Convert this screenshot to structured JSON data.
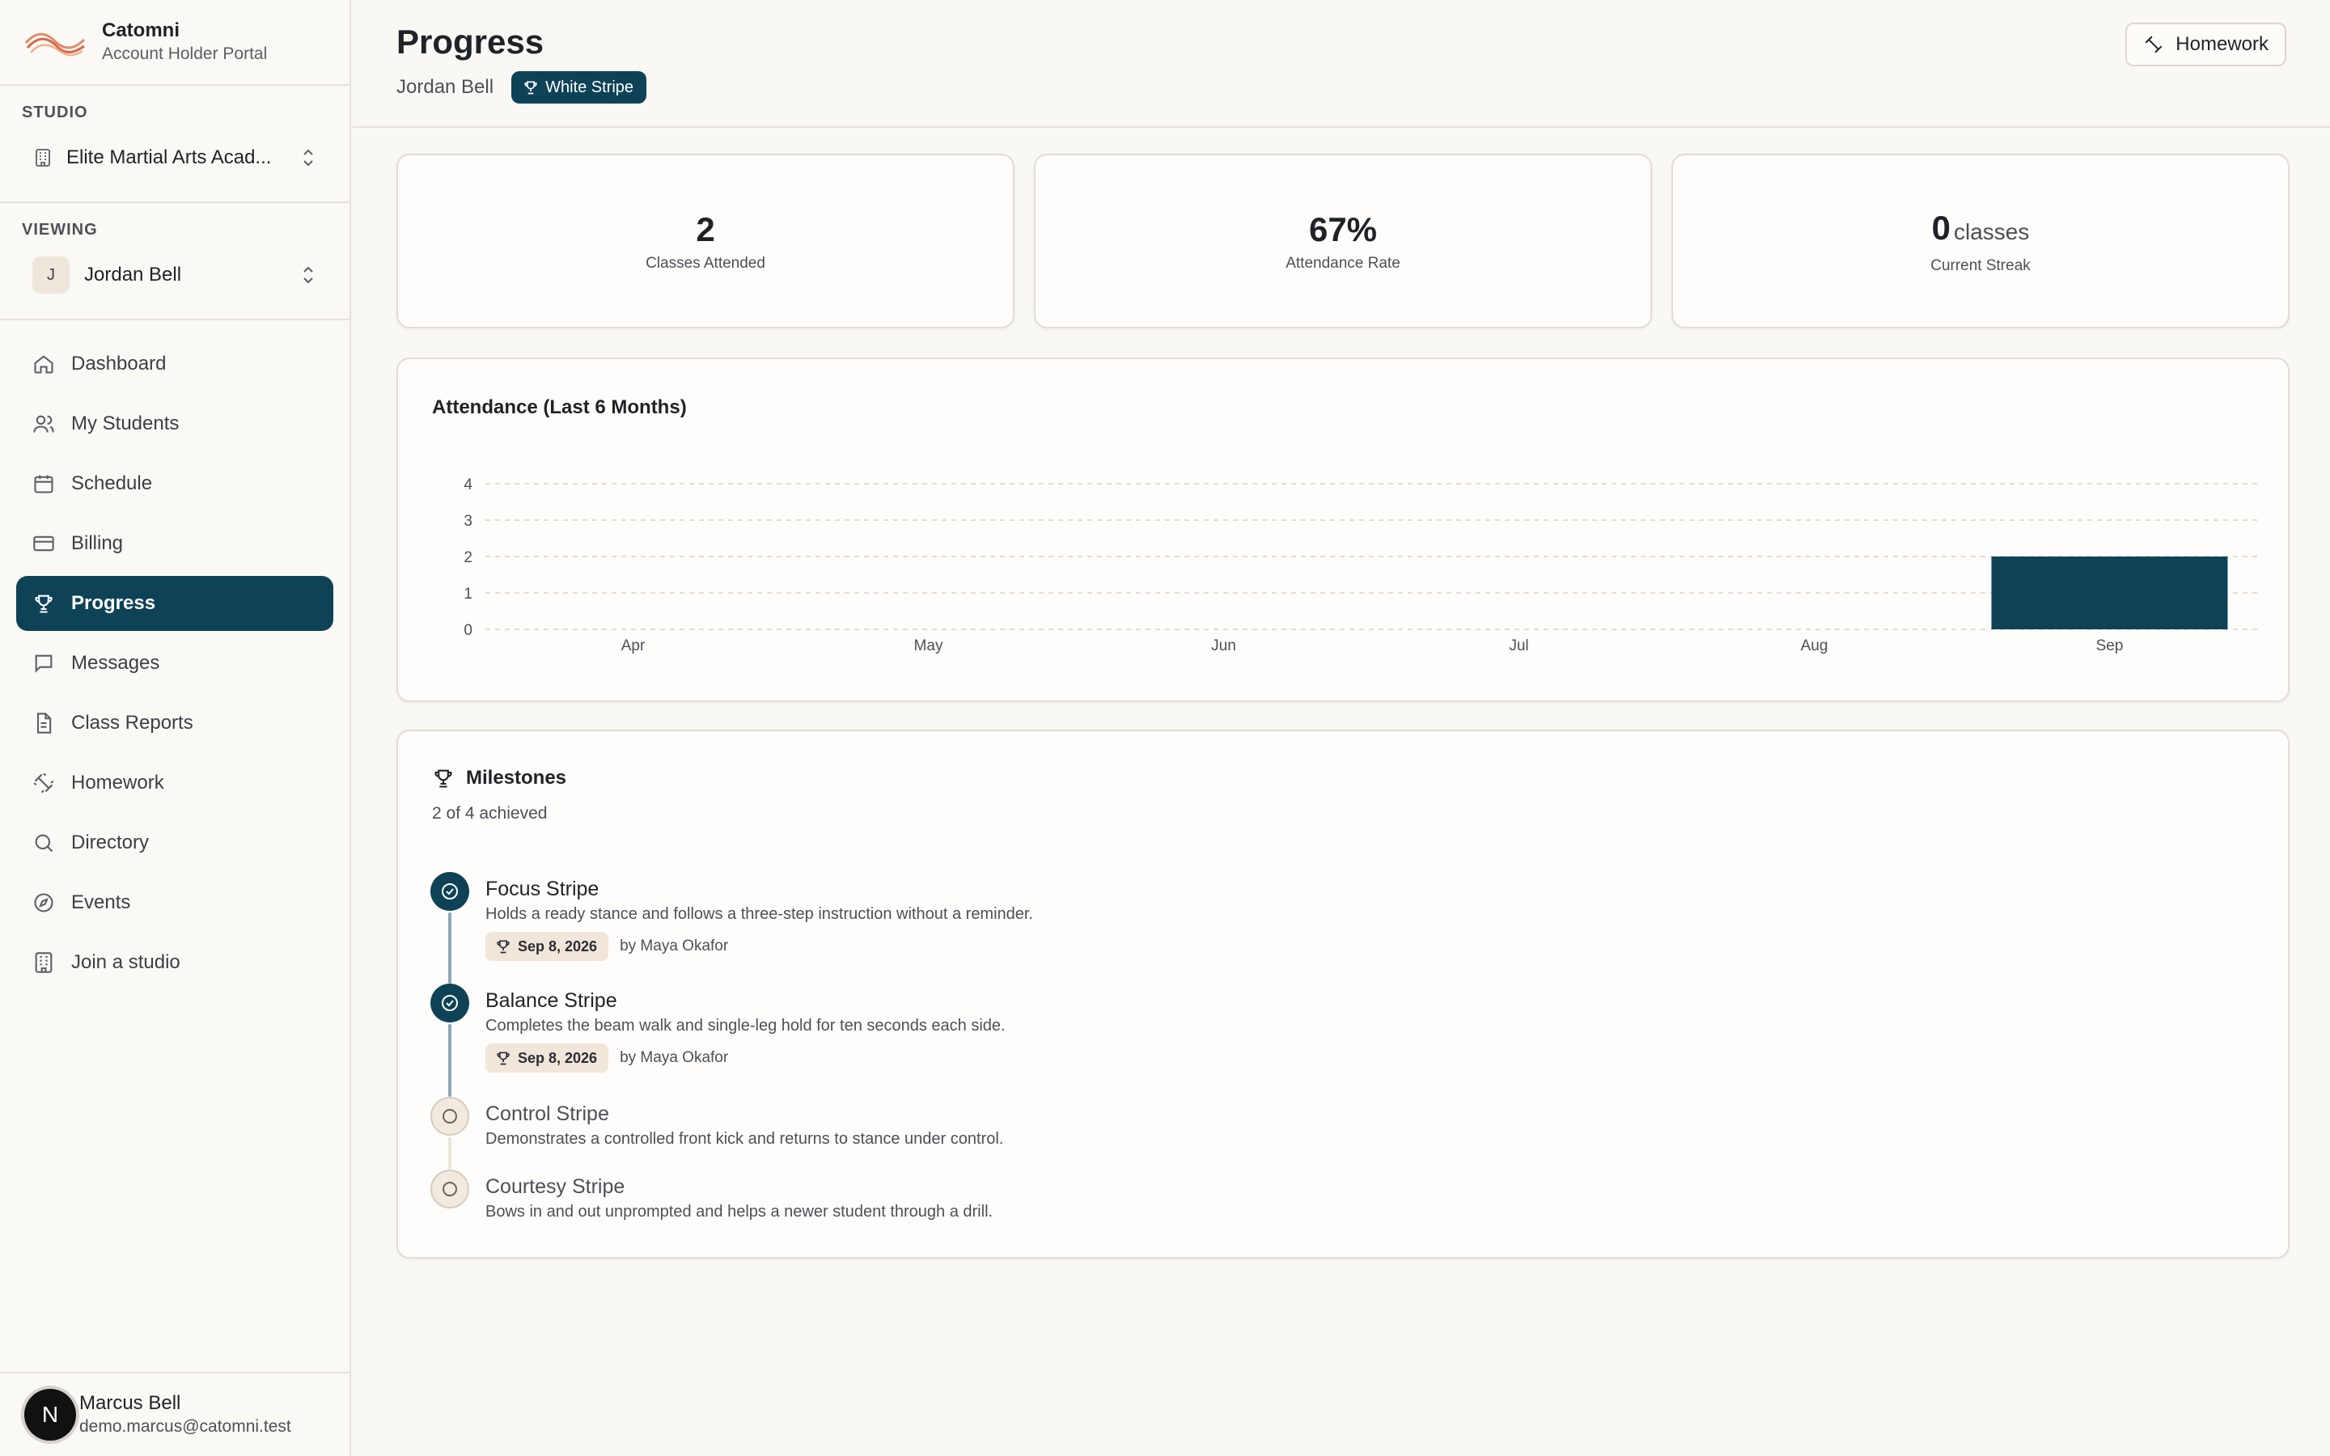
{
  "brand": {
    "name": "Catomni",
    "subtitle": "Account Holder Portal"
  },
  "sidebar": {
    "studio_label": "STUDIO",
    "studio_value": "Elite Martial Arts Acad...",
    "viewing_label": "VIEWING",
    "viewing_initial": "J",
    "viewing_value": "Jordan Bell",
    "items": [
      {
        "label": "Dashboard",
        "icon": "home-icon"
      },
      {
        "label": "My Students",
        "icon": "users-icon"
      },
      {
        "label": "Schedule",
        "icon": "calendar-icon"
      },
      {
        "label": "Billing",
        "icon": "credit-card-icon"
      },
      {
        "label": "Progress",
        "icon": "trophy-icon",
        "active": true
      },
      {
        "label": "Messages",
        "icon": "message-icon"
      },
      {
        "label": "Class Reports",
        "icon": "document-icon"
      },
      {
        "label": "Homework",
        "icon": "dumbbell-icon"
      },
      {
        "label": "Directory",
        "icon": "search-icon"
      },
      {
        "label": "Events",
        "icon": "compass-icon"
      },
      {
        "label": "Join a studio",
        "icon": "building-icon"
      }
    ]
  },
  "user": {
    "initial": "N",
    "name": "Marcus Bell",
    "email": "demo.marcus@catomni.test"
  },
  "header": {
    "title": "Progress",
    "student": "Jordan Bell",
    "rank": "White Stripe",
    "homework_button": "Homework"
  },
  "stats": [
    {
      "value": "2",
      "unit": "",
      "label": "Classes Attended"
    },
    {
      "value": "67%",
      "unit": "",
      "label": "Attendance Rate"
    },
    {
      "value": "0",
      "unit": "classes",
      "label": "Current Streak"
    }
  ],
  "chart_title": "Attendance (Last 6 Months)",
  "chart_data": {
    "type": "bar",
    "title": "Attendance (Last 6 Months)",
    "categories": [
      "Apr",
      "May",
      "Jun",
      "Jul",
      "Aug",
      "Sep"
    ],
    "values": [
      0,
      0,
      0,
      0,
      0,
      2
    ],
    "yticks": [
      0,
      1,
      2,
      3,
      4
    ],
    "ylim": [
      0,
      4
    ],
    "grid": true,
    "bar_color": "#0e4257"
  },
  "milestones": {
    "title": "Milestones",
    "count_text": "2 of 4 achieved",
    "items": [
      {
        "name": "Focus Stripe",
        "desc": "Holds a ready stance and follows a three-step instruction without a reminder.",
        "achieved": true,
        "date": "Sep 8, 2026",
        "by": "by Maya Okafor"
      },
      {
        "name": "Balance Stripe",
        "desc": "Completes the beam walk and single-leg hold for ten seconds each side.",
        "achieved": true,
        "date": "Sep 8, 2026",
        "by": "by Maya Okafor"
      },
      {
        "name": "Control Stripe",
        "desc": "Demonstrates a controlled front kick and returns to stance under control.",
        "achieved": false
      },
      {
        "name": "Courtesy Stripe",
        "desc": "Bows in and out unprompted and helps a newer student through a drill.",
        "achieved": false
      }
    ]
  },
  "colors": {
    "accent": "#0e4257",
    "background": "#faf8f4"
  }
}
